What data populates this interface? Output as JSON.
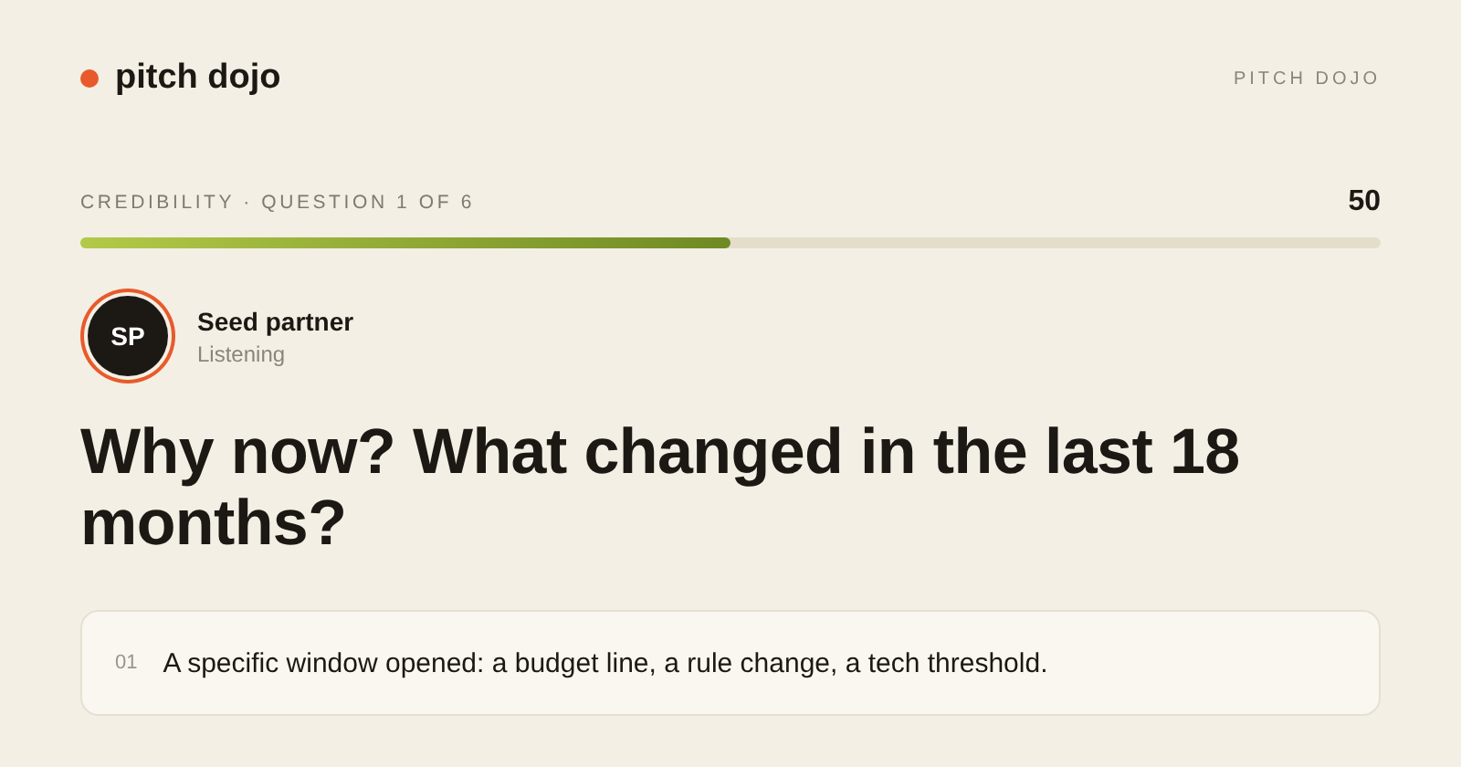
{
  "brand": {
    "name": "pitch dojo",
    "tag": "PITCH DOJO"
  },
  "progress": {
    "label": "CREDIBILITY · QUESTION 1 OF 6",
    "score": "50",
    "level": 0.5
  },
  "persona": {
    "initials": "SP",
    "name": "Seed partner",
    "status": "Listening"
  },
  "question": "Why now? What changed in the last 18 months?",
  "answers": [
    {
      "number": "01",
      "text": "A specific window opened: a budget line, a rule change, a tech threshold."
    }
  ]
}
